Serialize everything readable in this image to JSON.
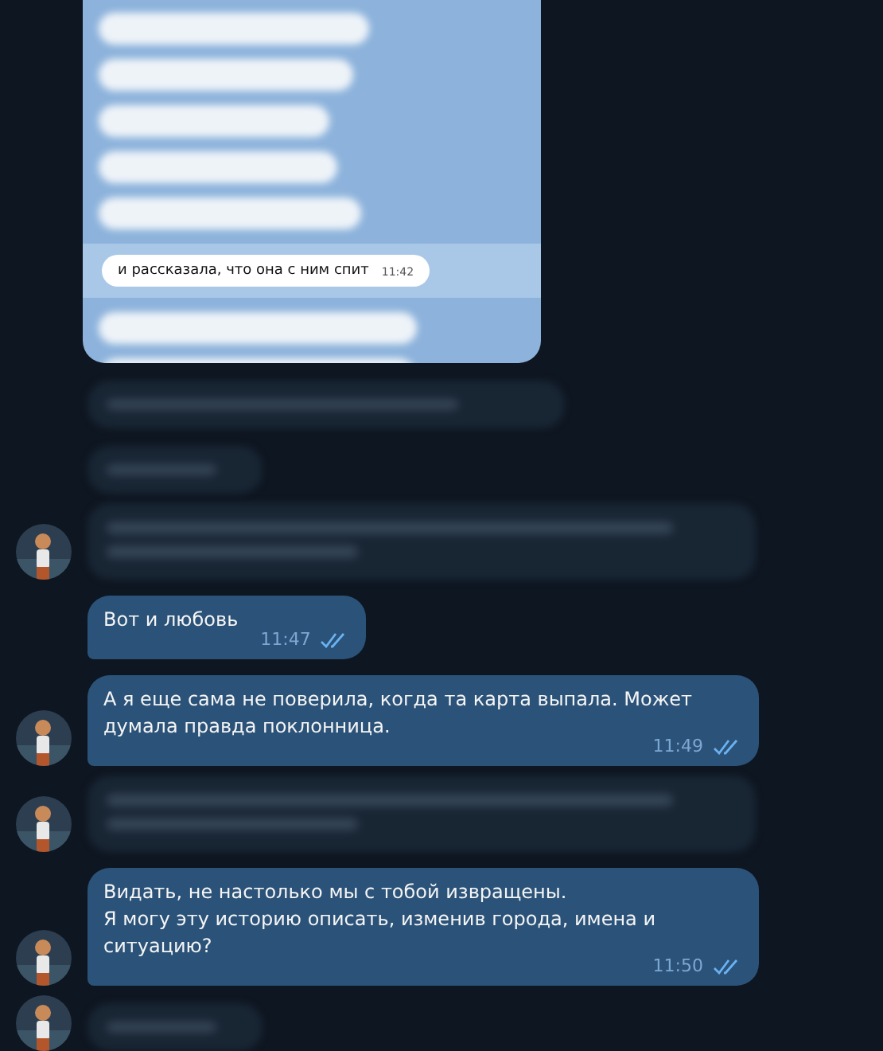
{
  "messages": [
    {
      "kind": "screenshot",
      "visible_message": {
        "text": "и рассказала, что она с ним спит",
        "time": "11:42"
      }
    },
    {
      "kind": "blurred_wide",
      "avatar": false
    },
    {
      "kind": "blurred_short",
      "avatar": false
    },
    {
      "kind": "blurred_two_line",
      "avatar": true
    },
    {
      "kind": "text",
      "text": "Вот и любовь",
      "time": "11:47",
      "read": true,
      "avatar": false
    },
    {
      "kind": "text",
      "text": "А я еще сама не поверила, когда та карта выпала. Может думала правда поклонница.",
      "time": "11:49",
      "read": true,
      "avatar": true
    },
    {
      "kind": "blurred_two_line",
      "avatar": true
    },
    {
      "kind": "text",
      "text": "Видать, не настолько мы с тобой извращены.\nЯ могу эту историю описать, изменив города, имена и ситуацию?",
      "time": "11:50",
      "read": true,
      "avatar": true
    },
    {
      "kind": "blurred_short",
      "avatar": true
    }
  ]
}
